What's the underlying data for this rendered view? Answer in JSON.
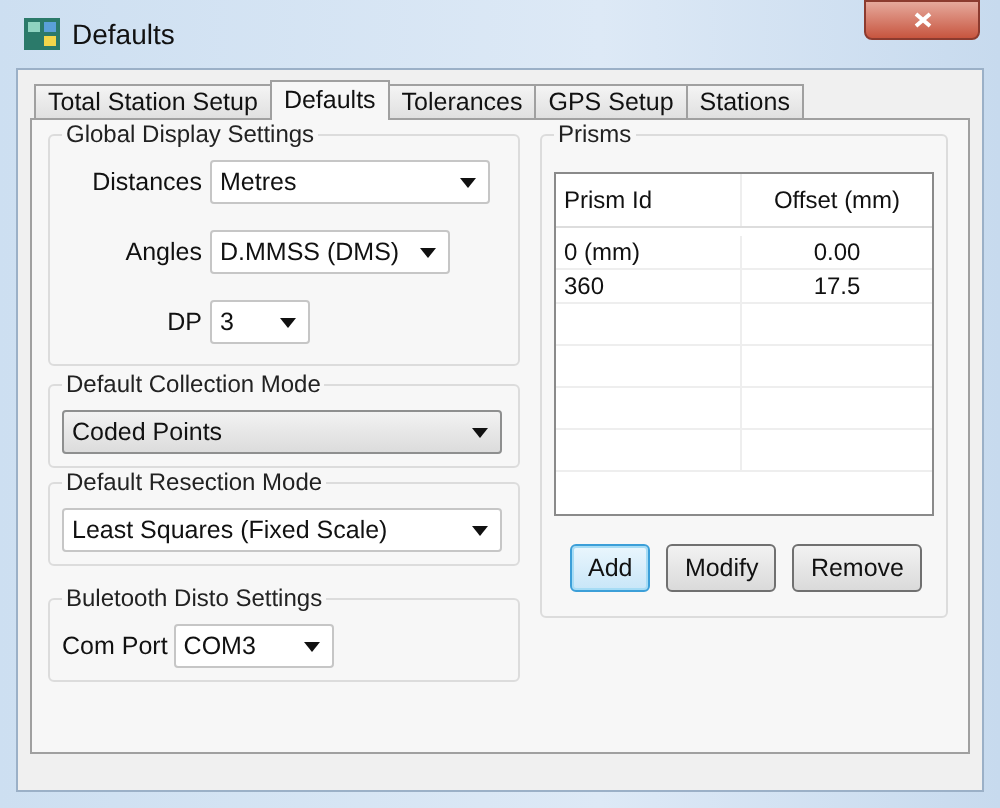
{
  "window": {
    "title": "Defaults"
  },
  "tabs": [
    {
      "label": "Total Station Setup",
      "selected": false
    },
    {
      "label": "Defaults",
      "selected": true
    },
    {
      "label": "Tolerances",
      "selected": false
    },
    {
      "label": "GPS Setup",
      "selected": false
    },
    {
      "label": "Stations",
      "selected": false
    }
  ],
  "global_display_settings": {
    "title": "Global Display Settings",
    "fields": [
      {
        "label": "Distances",
        "value": "Metres"
      },
      {
        "label": "Angles",
        "value": "D.MMSS (DMS)"
      },
      {
        "label": "DP",
        "value": "3"
      }
    ]
  },
  "collection_mode": {
    "title": "Default Collection Mode",
    "value": "Coded Points",
    "kind": "dropdown"
  },
  "resection_mode": {
    "title": "Default Resection Mode",
    "value": "Least Squares (Fixed Scale)",
    "kind": "editable"
  },
  "bluetooth": {
    "title": "Buletooth Disto Settings",
    "label": "Com Port",
    "value": "COM3",
    "kind": "editable"
  },
  "prisms": {
    "title": "Prisms",
    "columns": [
      "Prism Id",
      "Offset (mm)"
    ],
    "rows": [
      [
        "0 (mm)",
        "0.00"
      ],
      [
        "360",
        "17.5"
      ]
    ],
    "buttons": [
      {
        "label": "Add",
        "focused": true
      },
      {
        "label": "Modify",
        "focused": false
      },
      {
        "label": "Remove",
        "focused": false
      }
    ]
  }
}
